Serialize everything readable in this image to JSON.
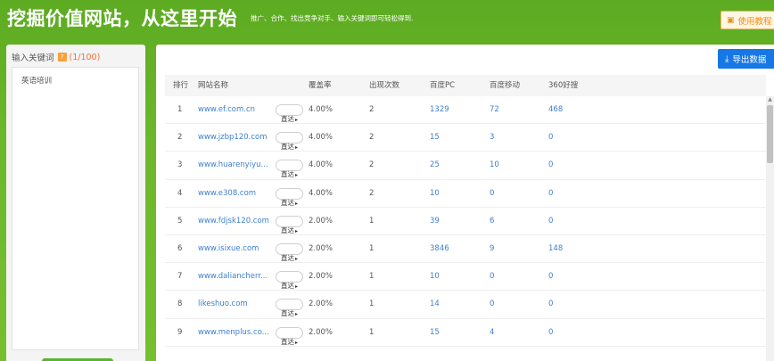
{
  "header": {
    "title": "挖掘价值网站，从这里开始",
    "subtitle": "推广、合作、找出竞争对手、输入关键词即可轻松得到.",
    "tutorial_label": "使用教程"
  },
  "keyword_panel": {
    "label": "输入关键词",
    "count": "(1/100)",
    "value": "英语培训"
  },
  "toolbar": {
    "export_label": "导出数据"
  },
  "table": {
    "columns": [
      "排行",
      "网站名称",
      "覆盖率",
      "出现次数",
      "百度PC",
      "百度移动",
      "360好搜"
    ],
    "go_label": "直达",
    "rows": [
      {
        "rank": "1",
        "site": "www.ef.com.cn",
        "coverage": "4.00%",
        "count": "2",
        "baidu_pc": "1329",
        "baidu_mobile": "72",
        "so360": "468"
      },
      {
        "rank": "2",
        "site": "www.jzbp120.com",
        "coverage": "4.00%",
        "count": "2",
        "baidu_pc": "15",
        "baidu_mobile": "3",
        "so360": "0"
      },
      {
        "rank": "3",
        "site": "www.huarenyiyu...",
        "coverage": "4.00%",
        "count": "2",
        "baidu_pc": "25",
        "baidu_mobile": "10",
        "so360": "0"
      },
      {
        "rank": "4",
        "site": "www.e308.com",
        "coverage": "4.00%",
        "count": "2",
        "baidu_pc": "10",
        "baidu_mobile": "0",
        "so360": "0"
      },
      {
        "rank": "5",
        "site": "www.fdjsk120.com",
        "coverage": "2.00%",
        "count": "1",
        "baidu_pc": "39",
        "baidu_mobile": "6",
        "so360": "0"
      },
      {
        "rank": "6",
        "site": "www.isixue.com",
        "coverage": "2.00%",
        "count": "1",
        "baidu_pc": "3846",
        "baidu_mobile": "9",
        "so360": "148"
      },
      {
        "rank": "7",
        "site": "www.daliancherr...",
        "coverage": "2.00%",
        "count": "1",
        "baidu_pc": "10",
        "baidu_mobile": "0",
        "so360": "0"
      },
      {
        "rank": "8",
        "site": "likeshuo.com",
        "coverage": "2.00%",
        "count": "1",
        "baidu_pc": "14",
        "baidu_mobile": "0",
        "so360": "0"
      },
      {
        "rank": "9",
        "site": "www.menplus.co...",
        "coverage": "2.00%",
        "count": "1",
        "baidu_pc": "15",
        "baidu_mobile": "4",
        "so360": "0"
      }
    ]
  },
  "icons": {
    "tutorial": "help-book-icon",
    "export": "download-icon",
    "go": "arrow-right-icon"
  },
  "colors": {
    "brand_green": "#6cb82a",
    "link_blue": "#3d7fd1",
    "export_blue": "#1677e5",
    "accent_orange": "#f08c1c"
  }
}
